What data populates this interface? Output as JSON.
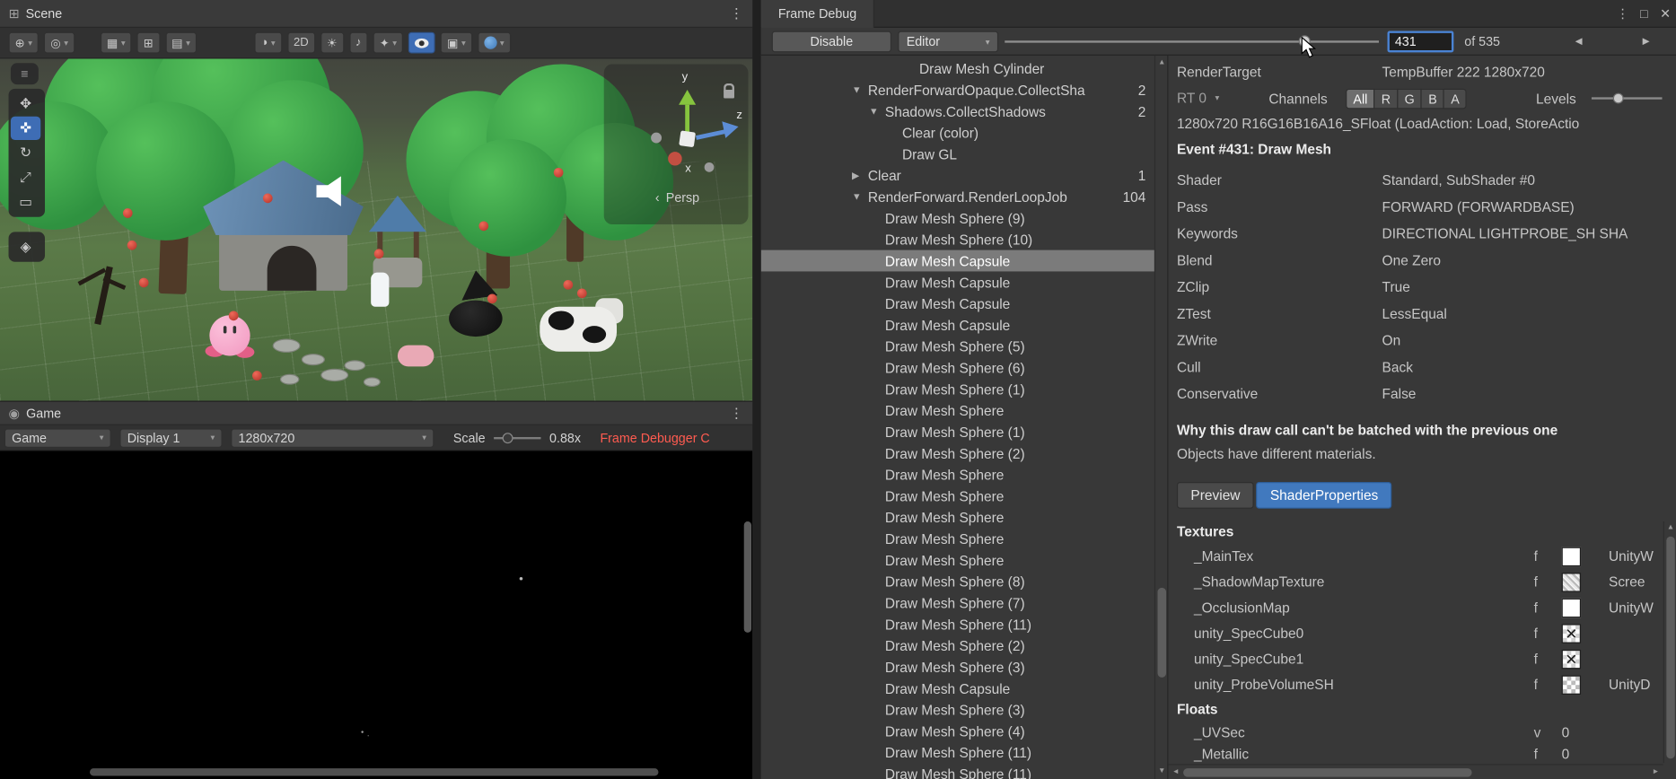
{
  "icons": {
    "menu": "≡",
    "more": "⋮",
    "close": "✕",
    "maximize": "□",
    "dropdown": "▾",
    "prev": "◄",
    "next": "►",
    "scroll_up": "▲",
    "scroll_down": "▼",
    "scroll_left": "◄",
    "scroll_right": "►",
    "scene_tab": "⊞",
    "game_tab": "◉",
    "tool_view": "✥",
    "tool_move": "✜",
    "tool_rotate": "↻",
    "tool_scale": "⤢",
    "tool_rect": "▭",
    "tool_transform": "◈",
    "handle_pos": "⊕",
    "handle_rot": "◎",
    "grid": "▦",
    "snap": "⊞",
    "increment": "▤",
    "shading": "◑",
    "light": "☀",
    "audio": "♪",
    "effects": "✦",
    "camera": "▣",
    "flip": "‹"
  },
  "scene": {
    "title": "Scene",
    "persp_label": "Persp",
    "axis": {
      "x": "x",
      "y": "y",
      "z": "z"
    },
    "toolbar": {
      "two_d_label": "2D"
    }
  },
  "game": {
    "title": "Game",
    "tab_dropdown": "Game",
    "display_dropdown": "Display 1",
    "resolution_dropdown": "1280x720",
    "scale_label": "Scale",
    "scale_value": "0.88x",
    "warning": "Frame Debugger C"
  },
  "frame_debug": {
    "title": "Frame Debug",
    "disable_button": "Disable",
    "target_dropdown": "Editor",
    "frame_number": "431",
    "frame_total": "of 535",
    "tree": [
      {
        "depth": 5,
        "label": "Draw Mesh Cylinder"
      },
      {
        "depth": 2,
        "arrow": "down",
        "label": "RenderForwardOpaque.CollectSha",
        "count": "2"
      },
      {
        "depth": 3,
        "arrow": "down",
        "label": "Shadows.CollectShadows",
        "count": "2"
      },
      {
        "depth": 4,
        "label": "Clear (color)"
      },
      {
        "depth": 4,
        "label": "Draw GL"
      },
      {
        "depth": 2,
        "arrow": "right",
        "label": "Clear",
        "count": "1"
      },
      {
        "depth": 2,
        "arrow": "down",
        "label": "RenderForward.RenderLoopJob",
        "count": "104"
      },
      {
        "depth": 3,
        "label": "Draw Mesh Sphere (9)"
      },
      {
        "depth": 3,
        "label": "Draw Mesh Sphere (10)"
      },
      {
        "depth": 3,
        "label": "Draw Mesh Capsule",
        "selected": true
      },
      {
        "depth": 3,
        "label": "Draw Mesh Capsule"
      },
      {
        "depth": 3,
        "label": "Draw Mesh Capsule"
      },
      {
        "depth": 3,
        "label": "Draw Mesh Capsule"
      },
      {
        "depth": 3,
        "label": "Draw Mesh Sphere (5)"
      },
      {
        "depth": 3,
        "label": "Draw Mesh Sphere (6)"
      },
      {
        "depth": 3,
        "label": "Draw Mesh Sphere (1)"
      },
      {
        "depth": 3,
        "label": "Draw Mesh Sphere"
      },
      {
        "depth": 3,
        "label": "Draw Mesh Sphere (1)"
      },
      {
        "depth": 3,
        "label": "Draw Mesh Sphere (2)"
      },
      {
        "depth": 3,
        "label": "Draw Mesh Sphere"
      },
      {
        "depth": 3,
        "label": "Draw Mesh Sphere"
      },
      {
        "depth": 3,
        "label": "Draw Mesh Sphere"
      },
      {
        "depth": 3,
        "label": "Draw Mesh Sphere"
      },
      {
        "depth": 3,
        "label": "Draw Mesh Sphere"
      },
      {
        "depth": 3,
        "label": "Draw Mesh Sphere (8)"
      },
      {
        "depth": 3,
        "label": "Draw Mesh Sphere (7)"
      },
      {
        "depth": 3,
        "label": "Draw Mesh Sphere (11)"
      },
      {
        "depth": 3,
        "label": "Draw Mesh Sphere (2)"
      },
      {
        "depth": 3,
        "label": "Draw Mesh Sphere (3)"
      },
      {
        "depth": 3,
        "label": "Draw Mesh Capsule"
      },
      {
        "depth": 3,
        "label": "Draw Mesh Sphere (3)"
      },
      {
        "depth": 3,
        "label": "Draw Mesh Sphere (4)"
      },
      {
        "depth": 3,
        "label": "Draw Mesh Sphere (11)"
      },
      {
        "depth": 3,
        "label": "Draw Mesh Sphere (11)"
      }
    ],
    "details": {
      "render_target_label": "RenderTarget",
      "render_target_value": "TempBuffer 222 1280x720",
      "rt_label": "RT 0",
      "channels_label": "Channels",
      "channels": [
        "All",
        "R",
        "G",
        "B",
        "A"
      ],
      "levels_label": "Levels",
      "format_line": "1280x720 R16G16B16A16_SFloat (LoadAction: Load, StoreActio",
      "event_title": "Event #431: Draw Mesh",
      "properties": [
        {
          "label": "Shader",
          "value": "Standard, SubShader #0"
        },
        {
          "label": "Pass",
          "value": "FORWARD (FORWARDBASE)"
        },
        {
          "label": "Keywords",
          "value": "DIRECTIONAL LIGHTPROBE_SH SHA"
        },
        {
          "label": "Blend",
          "value": "One Zero"
        },
        {
          "label": "ZClip",
          "value": "True"
        },
        {
          "label": "ZTest",
          "value": "LessEqual"
        },
        {
          "label": "ZWrite",
          "value": "On"
        },
        {
          "label": "Cull",
          "value": "Back"
        },
        {
          "label": "Conservative",
          "value": "False"
        }
      ],
      "batch_title": "Why this draw call can't be batched with the previous one",
      "batch_reason": "Objects have different materials.",
      "tabs": [
        "Preview",
        "ShaderProperties"
      ],
      "textures_title": "Textures",
      "textures": [
        {
          "name": "_MainTex",
          "flag": "f",
          "swatch": "white",
          "value": "UnityW"
        },
        {
          "name": "_ShadowMapTexture",
          "flag": "f",
          "swatch": "noise",
          "value": "Scree"
        },
        {
          "name": "_OcclusionMap",
          "flag": "f",
          "swatch": "white",
          "value": "UnityW"
        },
        {
          "name": "unity_SpecCube0",
          "flag": "f",
          "swatch": "cube",
          "value": ""
        },
        {
          "name": "unity_SpecCube1",
          "flag": "f",
          "swatch": "cube",
          "value": ""
        },
        {
          "name": "unity_ProbeVolumeSH",
          "flag": "f",
          "swatch": "checker",
          "value": "UnityD"
        }
      ],
      "floats_title": "Floats",
      "floats": [
        {
          "name": "_UVSec",
          "flag": "v",
          "value": "0"
        },
        {
          "name": "_Metallic",
          "flag": "f",
          "value": "0"
        }
      ]
    }
  }
}
